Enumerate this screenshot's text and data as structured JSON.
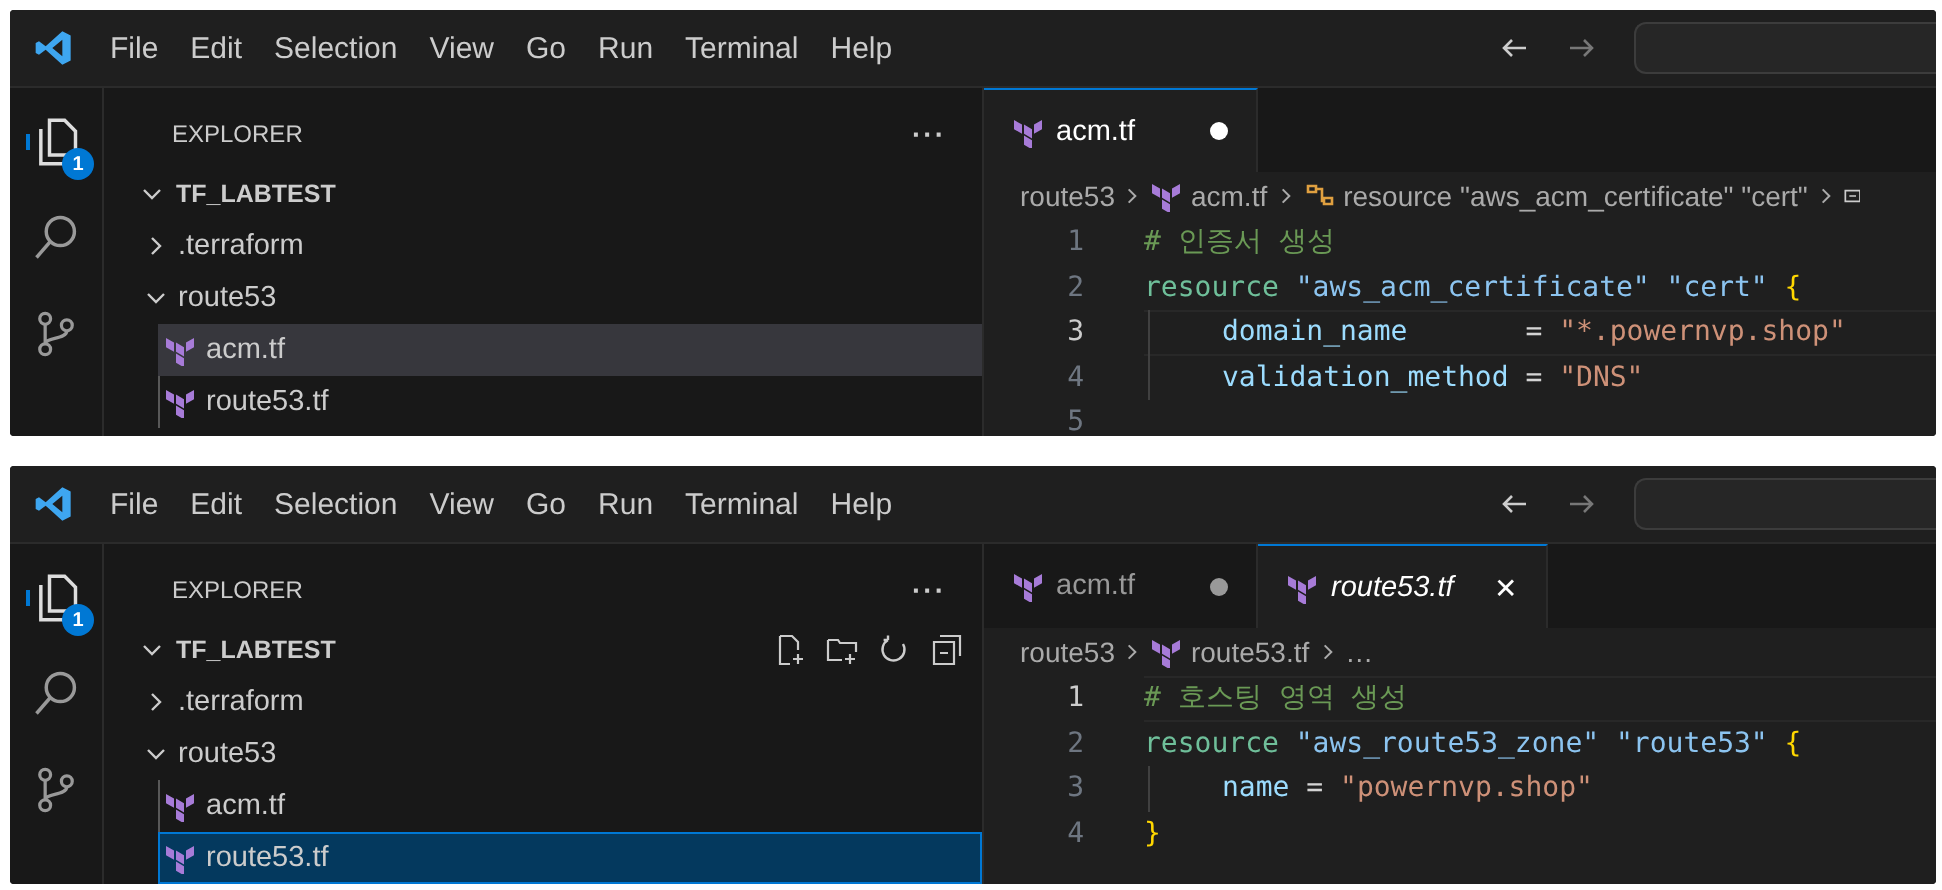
{
  "panels": [
    {
      "menu": [
        "File",
        "Edit",
        "Selection",
        "View",
        "Go",
        "Run",
        "Terminal",
        "Help"
      ],
      "explorer": {
        "title": "EXPLORER",
        "more": "···",
        "badge": "1",
        "root": "TF_LABTEST",
        "root_expanded": true,
        "show_actions": false,
        "focused": false,
        "tree": [
          {
            "label": ".terraform",
            "kind": "folder",
            "expanded": false,
            "selected": false
          },
          {
            "label": "route53",
            "kind": "folder",
            "expanded": true,
            "selected": false,
            "children": [
              {
                "label": "acm.tf",
                "kind": "terraform",
                "selected": true
              },
              {
                "label": "route53.tf",
                "kind": "terraform",
                "selected": false
              }
            ]
          }
        ]
      },
      "tabs": [
        {
          "label": "acm.tf",
          "selected": true,
          "modified": true,
          "preview": false
        }
      ],
      "breadcrumbs": [
        {
          "label": "route53",
          "kind": "folder"
        },
        {
          "label": "acm.tf",
          "kind": "terraform"
        },
        {
          "label": "resource \"aws_acm_certificate\" \"cert\"",
          "kind": "symbol"
        },
        {
          "kind": "block"
        }
      ],
      "code": [
        {
          "number": "1",
          "current": false,
          "indented": false,
          "tokens": [
            {
              "text": "# 인증서 생성",
              "kind": "comment"
            }
          ]
        },
        {
          "number": "2",
          "current": false,
          "indented": false,
          "tokens": [
            {
              "text": "resource ",
              "kind": "keyword"
            },
            {
              "text": "\"aws_acm_certificate\" \"cert\" ",
              "kind": "label"
            },
            {
              "text": "{",
              "kind": "brace"
            }
          ]
        },
        {
          "number": "3",
          "current": true,
          "indented": true,
          "tokens": [
            {
              "text": "domain_name",
              "kind": "attr"
            },
            {
              "text": "       = ",
              "kind": "punct"
            },
            {
              "text": "\"*.powernvp.shop\"",
              "kind": "string"
            }
          ]
        },
        {
          "number": "4",
          "current": false,
          "indented": true,
          "tokens": [
            {
              "text": "validation_method",
              "kind": "attr"
            },
            {
              "text": " = ",
              "kind": "punct"
            },
            {
              "text": "\"DNS\"",
              "kind": "string"
            }
          ]
        },
        {
          "number": "5",
          "current": false,
          "indented": false
        }
      ]
    },
    {
      "menu": [
        "File",
        "Edit",
        "Selection",
        "View",
        "Go",
        "Run",
        "Terminal",
        "Help"
      ],
      "explorer": {
        "title": "EXPLORER",
        "more": "···",
        "badge": "1",
        "root": "TF_LABTEST",
        "root_expanded": true,
        "show_actions": true,
        "focused": true,
        "tree": [
          {
            "label": ".terraform",
            "kind": "folder",
            "expanded": false,
            "selected": false
          },
          {
            "label": "route53",
            "kind": "folder",
            "expanded": true,
            "selected": false,
            "children": [
              {
                "label": "acm.tf",
                "kind": "terraform",
                "selected": false
              },
              {
                "label": "route53.tf",
                "kind": "terraform",
                "selected": true
              }
            ]
          }
        ]
      },
      "tabs": [
        {
          "label": "acm.tf",
          "selected": false,
          "modified": true,
          "preview": false
        },
        {
          "label": "route53.tf",
          "selected": true,
          "modified": false,
          "preview": true,
          "close": "✕"
        }
      ],
      "breadcrumbs": [
        {
          "label": "route53",
          "kind": "folder"
        },
        {
          "label": "route53.tf",
          "kind": "terraform"
        },
        {
          "label": "…",
          "kind": "more"
        }
      ],
      "code": [
        {
          "number": "1",
          "current": true,
          "indented": false,
          "tokens": [
            {
              "text": "# 호스팅 영역 생성",
              "kind": "comment"
            }
          ]
        },
        {
          "number": "2",
          "current": false,
          "indented": false,
          "tokens": [
            {
              "text": "resource ",
              "kind": "keyword"
            },
            {
              "text": "\"aws_route53_zone\" \"route53\" ",
              "kind": "label"
            },
            {
              "text": "{",
              "kind": "brace"
            }
          ]
        },
        {
          "number": "3",
          "current": false,
          "indented": true,
          "tokens": [
            {
              "text": "name",
              "kind": "attr"
            },
            {
              "text": " = ",
              "kind": "punct"
            },
            {
              "text": "\"powernvp.shop\"",
              "kind": "string"
            }
          ]
        },
        {
          "number": "4",
          "current": false,
          "indented": false,
          "tokens": [
            {
              "text": "}",
              "kind": "brace"
            }
          ]
        }
      ]
    }
  ]
}
